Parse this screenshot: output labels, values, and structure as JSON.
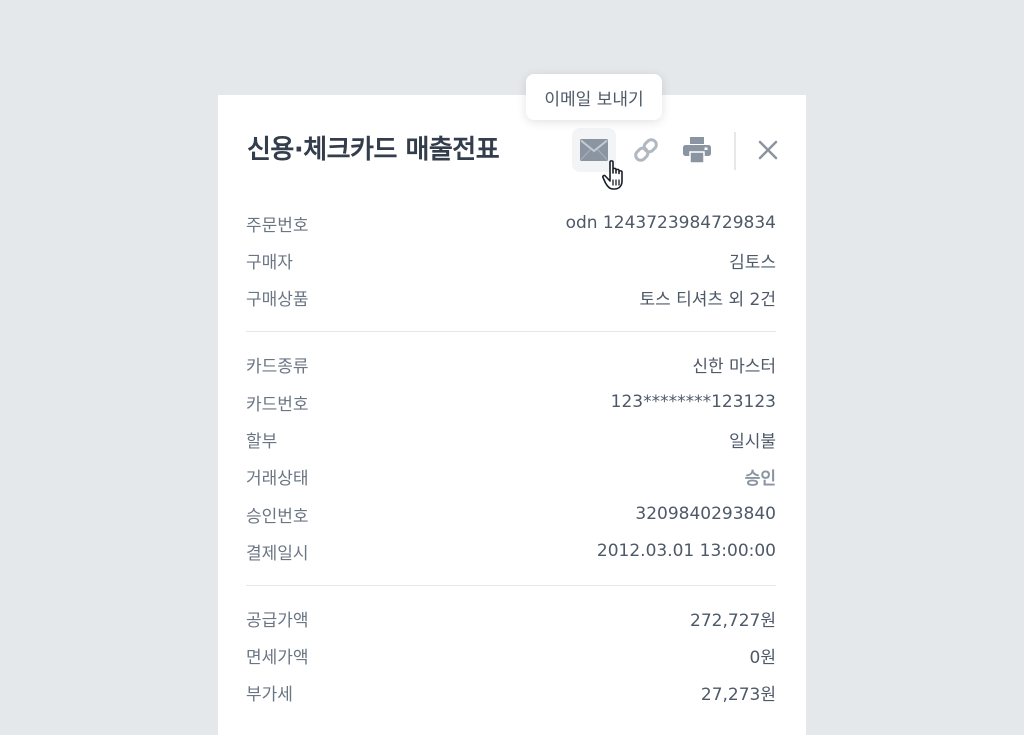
{
  "receipt": {
    "title": "신용·체크카드 매출전표",
    "toolbar": {
      "email_icon": "mail-icon",
      "link_icon": "link-icon",
      "print_icon": "printer-icon",
      "close_icon": "close-icon"
    },
    "tooltip": "이메일 보내기",
    "sections": [
      {
        "rows": [
          {
            "label": "주문번호",
            "value": "odn 1243723984729834"
          },
          {
            "label": "구매자",
            "value": "김토스"
          },
          {
            "label": "구매상품",
            "value": "토스 티셔츠 외 2건"
          }
        ]
      },
      {
        "rows": [
          {
            "label": "카드종류",
            "value": "신한 마스터"
          },
          {
            "label": "카드번호",
            "value": "123********123123"
          },
          {
            "label": "할부",
            "value": "일시불"
          },
          {
            "label": "거래상태",
            "value": "승인"
          },
          {
            "label": "승인번호",
            "value": "3209840293840"
          },
          {
            "label": "결제일시",
            "value": "2012.03.01 13:00:00"
          }
        ]
      },
      {
        "rows": [
          {
            "label": "공급가액",
            "value": "272,727원"
          },
          {
            "label": "면세가액",
            "value": "0원"
          },
          {
            "label": "부가세",
            "value": "27,273원"
          }
        ]
      }
    ]
  },
  "colors": {
    "background": "#e5e8eb",
    "card": "#ffffff",
    "text_primary": "#333d4b",
    "text_label": "#6b7684",
    "status_muted": "#8b95a1",
    "icon": "#8b95a1"
  }
}
